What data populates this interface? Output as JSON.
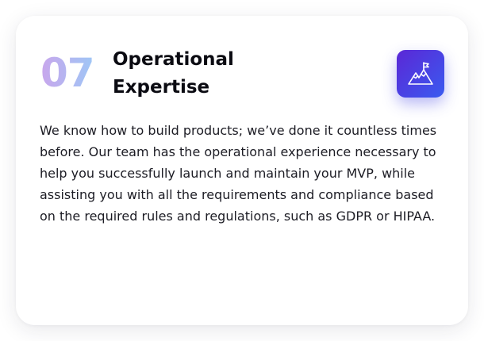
{
  "card": {
    "number": "07",
    "title_line1": "Operational",
    "title_line2": "Expertise",
    "icon": "mountain-flag-icon",
    "description": "We know how to build products; we’ve done it countless times before. Our team has the operational experience necessary to help you successfully launch and maintain your MVP, while assisting you with all the requirements and compliance based on the required rules and regulations, such as GDPR or HIPAA."
  },
  "colors": {
    "number_gradient_start": "#c9a6ec",
    "number_gradient_end": "#9ec7f6",
    "icon_gradient_start": "#5b27d6",
    "icon_gradient_end": "#3a5bf0",
    "title": "#0b0b12",
    "text": "#1c1c24"
  }
}
